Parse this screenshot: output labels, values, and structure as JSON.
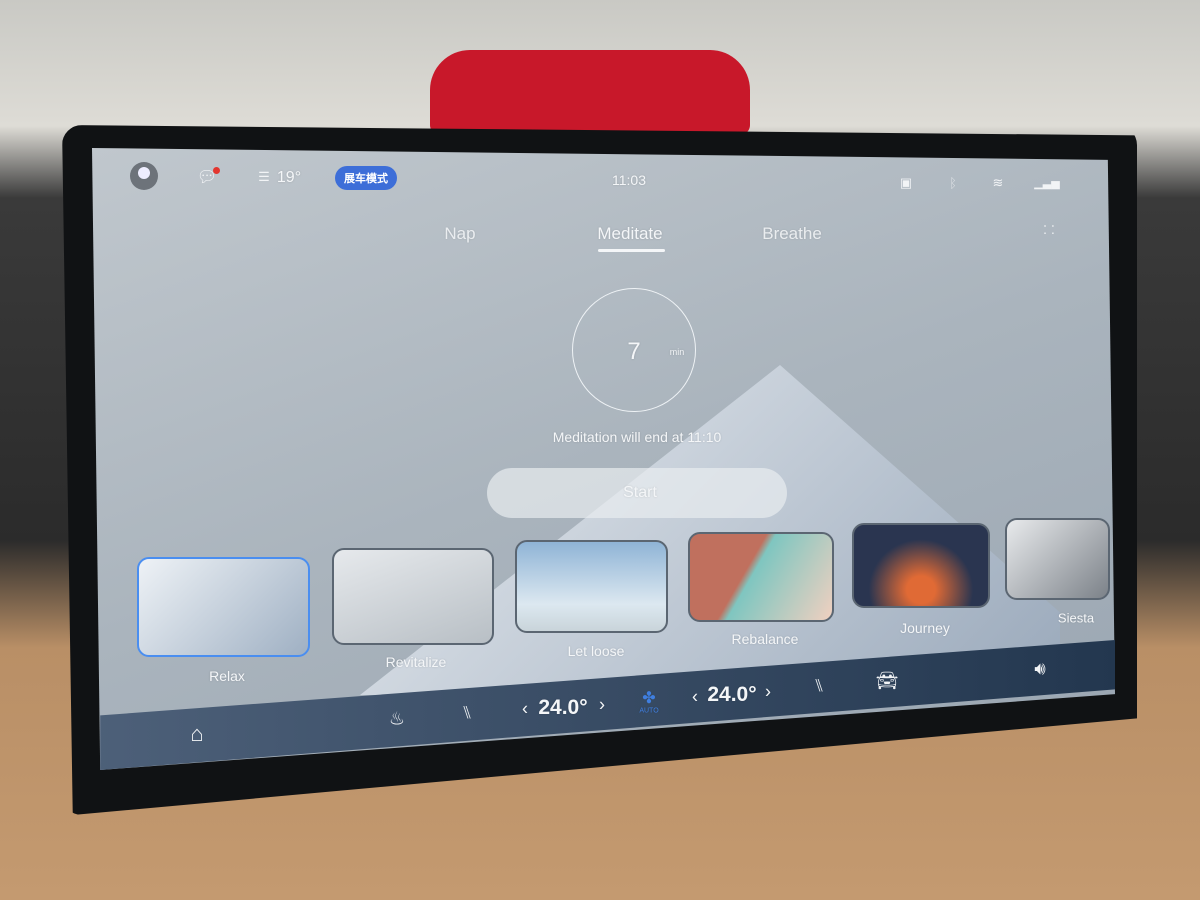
{
  "status_bar": {
    "temperature": "19°",
    "mode_badge": "展车模式",
    "time": "11:03",
    "icons": [
      "user-avatar",
      "message-icon",
      "weather-icon",
      "camera-icon",
      "bluetooth-icon",
      "wifi-icon",
      "4g-signal-icon"
    ]
  },
  "tabs": [
    {
      "label": "Nap"
    },
    {
      "label": "Meditate",
      "active": true
    },
    {
      "label": "Breathe"
    }
  ],
  "timer": {
    "value": "7",
    "unit": "min",
    "end_text": "Meditation will end at 11:10"
  },
  "start_label": "Start",
  "scenes": [
    {
      "label": "Relax",
      "selected": true,
      "color": "#dfe6ee"
    },
    {
      "label": "Revitalize",
      "color": "#cfd5db"
    },
    {
      "label": "Let loose",
      "color": "#a9c4dc"
    },
    {
      "label": "Rebalance",
      "color": "#c98a7b"
    },
    {
      "label": "Journey",
      "color": "#2a3550"
    },
    {
      "label": "Siesta",
      "color": "#9ea4aa"
    }
  ],
  "climate": {
    "left_temp": "24.0°",
    "right_temp": "24.0°",
    "fan_mode": "AUTO",
    "prev": "‹",
    "next": "›"
  },
  "colors": {
    "accent": "#3d6ed8",
    "selected_border": "#4a8ef0",
    "fan": "#3f7fe0"
  }
}
